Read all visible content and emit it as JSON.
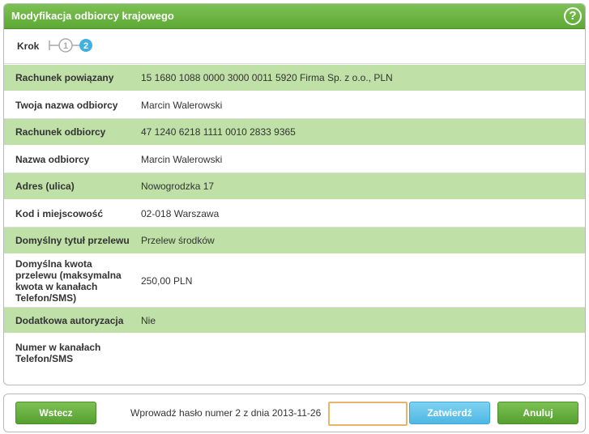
{
  "panel": {
    "title": "Modyfikacja odbiorcy krajowego",
    "help_icon": "?"
  },
  "steps": {
    "label": "Krok",
    "step1": "1",
    "step2": "2"
  },
  "rows": [
    {
      "label": "Rachunek powiązany",
      "value": "15 1680 1088 0000 3000 0011 5920 Firma Sp. z o.o., PLN"
    },
    {
      "label": "Twoja nazwa odbiorcy",
      "value": "Marcin Walerowski"
    },
    {
      "label": "Rachunek odbiorcy",
      "value": "47 1240 6218 1111 0010 2833 9365"
    },
    {
      "label": "Nazwa odbiorcy",
      "value": "Marcin Walerowski"
    },
    {
      "label": "Adres (ulica)",
      "value": "Nowogrodzka 17"
    },
    {
      "label": "Kod i miejscowość",
      "value": "02-018 Warszawa"
    },
    {
      "label": "Domyślny tytuł przelewu",
      "value": "Przelew środków"
    },
    {
      "label": "Domyślna kwota przelewu (maksymalna kwota w kanałach Telefon/SMS)",
      "value": "250,00 PLN"
    },
    {
      "label": "Dodatkowa autoryzacja",
      "value": "Nie"
    },
    {
      "label": "Numer w kanałach Telefon/SMS",
      "value": ""
    }
  ],
  "footer": {
    "back_label": "Wstecz",
    "prompt": "Wprowadź hasło numer 2 z dnia 2013-11-26",
    "password_value": "",
    "confirm_label": "Zatwierdź",
    "cancel_label": "Anuluj"
  },
  "colors": {
    "title_green": "#5ea935",
    "row_green": "#bfe0a6",
    "step_blue": "#3fb0e0",
    "confirm_blue": "#4eb8e3",
    "input_border": "#e8b46a"
  }
}
